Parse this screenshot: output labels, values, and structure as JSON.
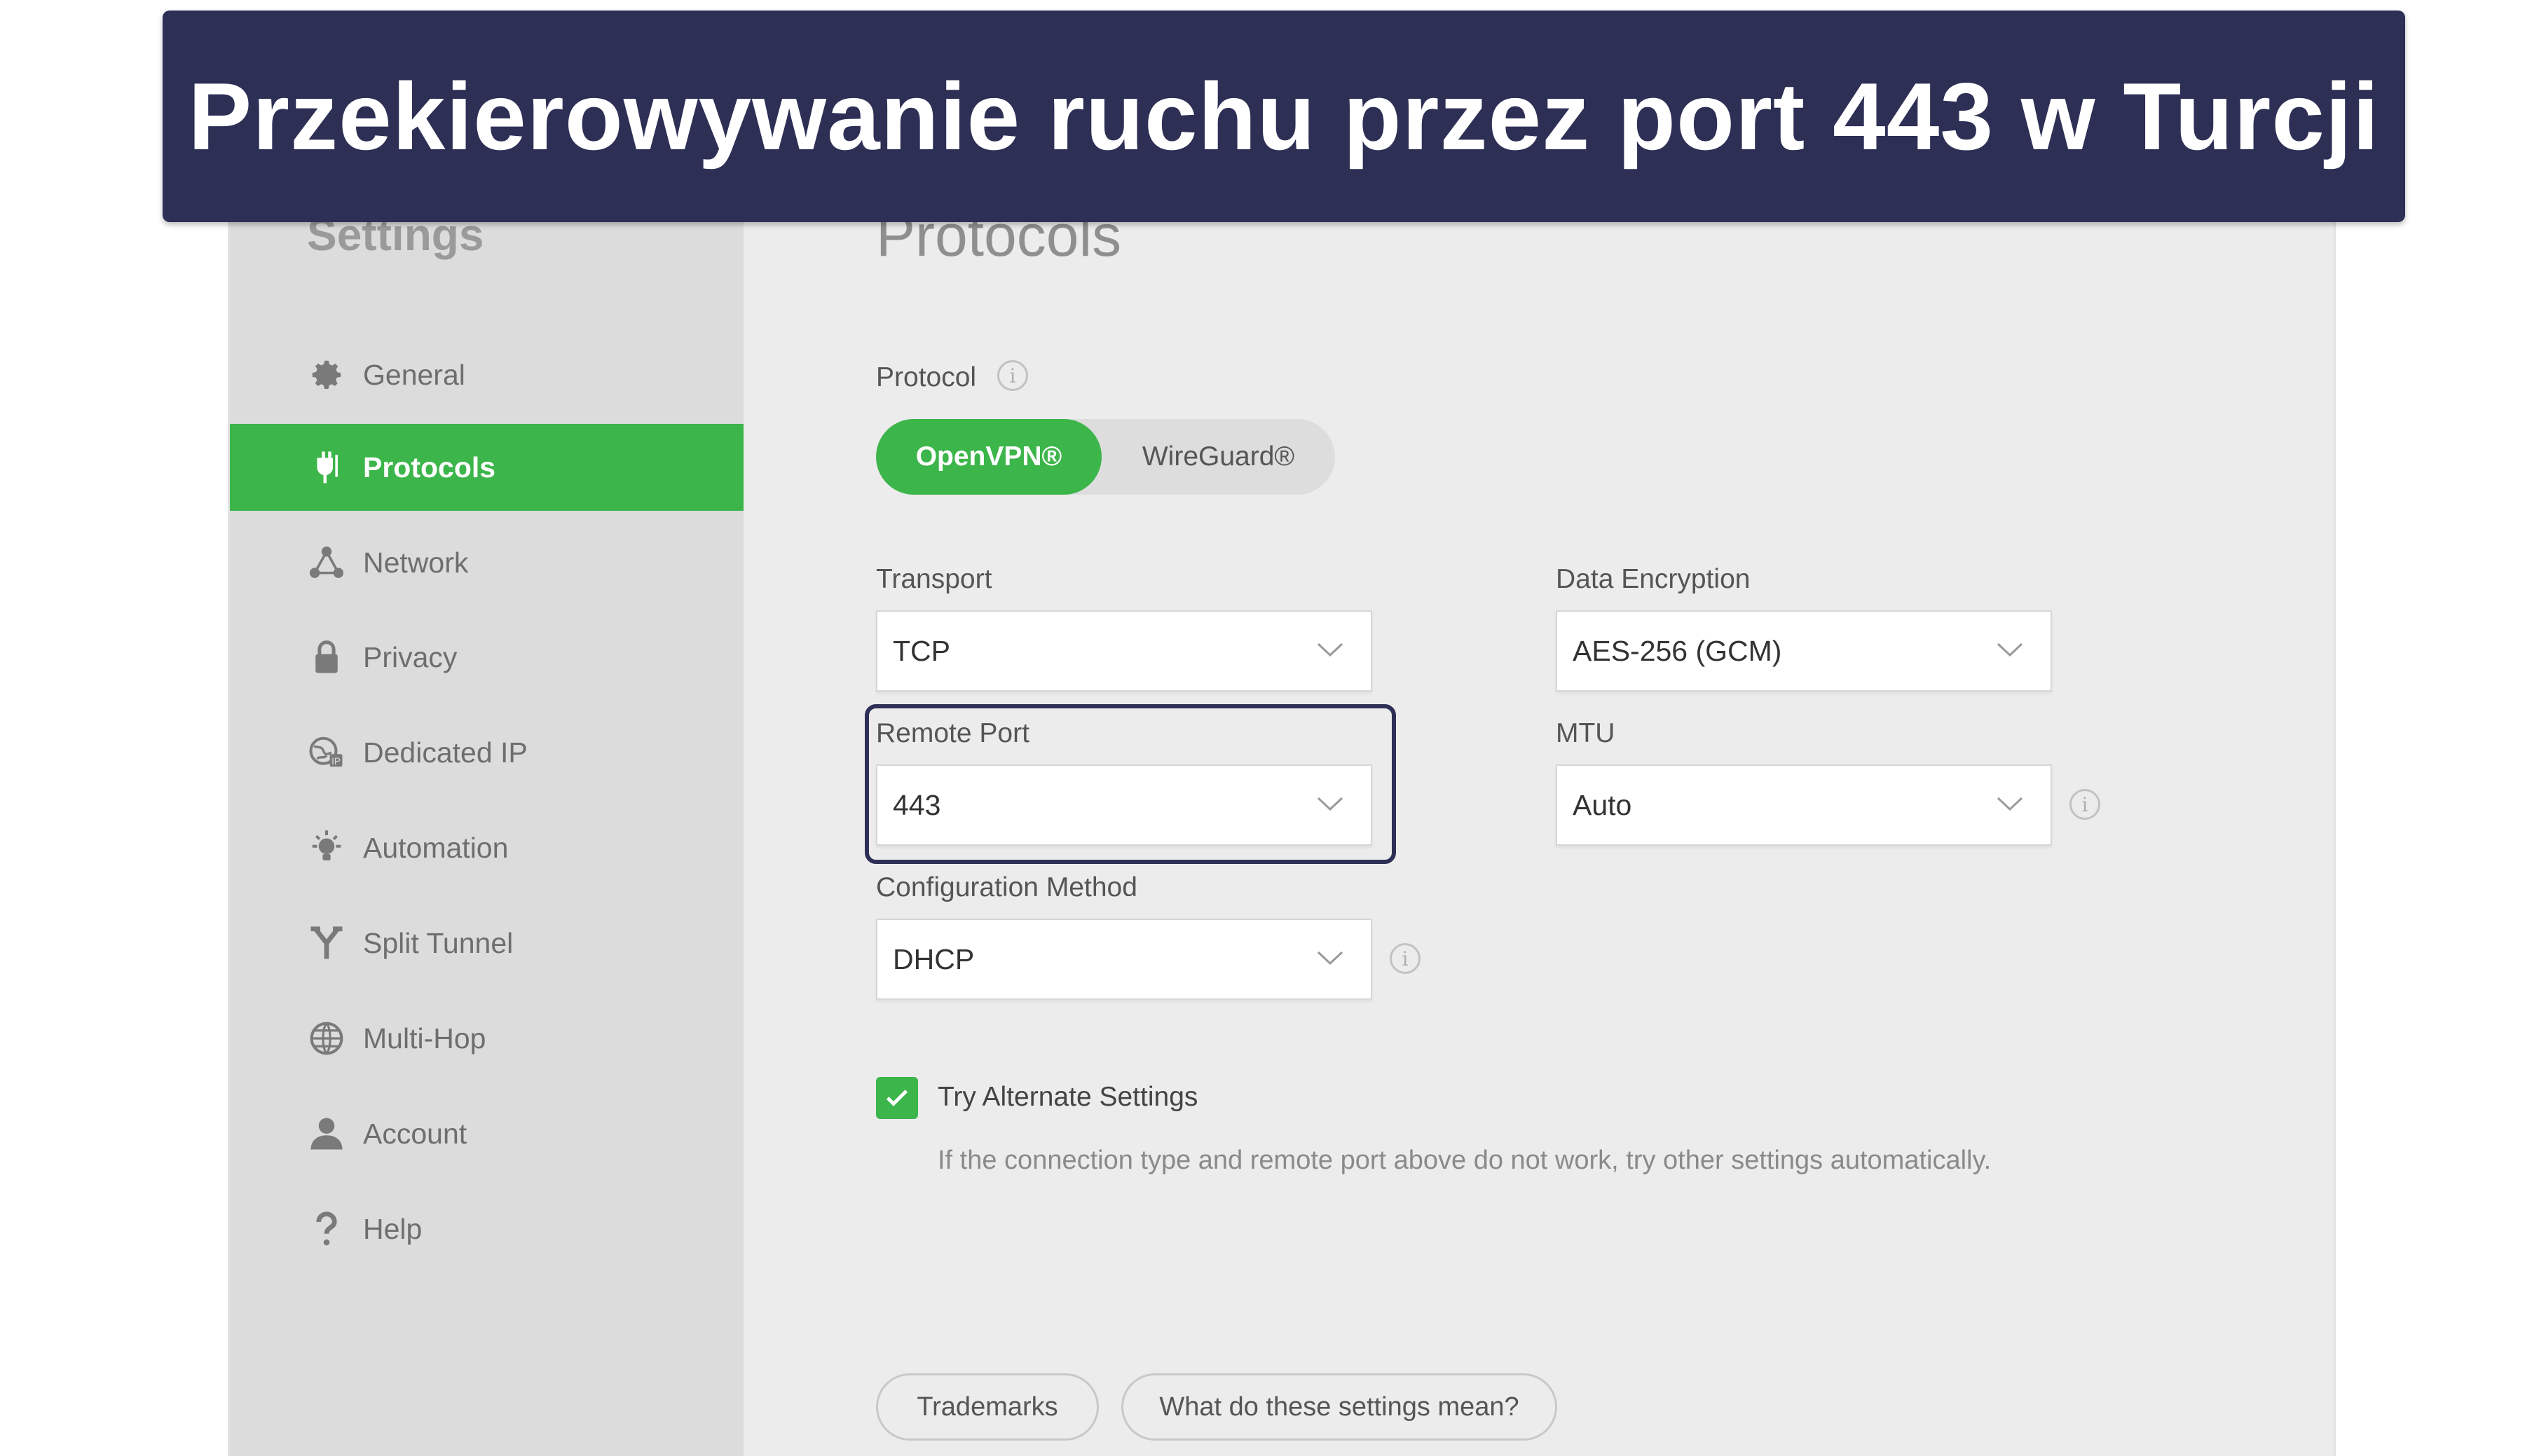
{
  "banner": {
    "text": "Przekierowywanie ruchu przez port 443 w Turcji"
  },
  "sidebar": {
    "title": "Settings",
    "items": [
      {
        "label": "General",
        "icon": "gear-icon"
      },
      {
        "label": "Protocols",
        "icon": "protocols-icon",
        "active": true
      },
      {
        "label": "Network",
        "icon": "network-icon"
      },
      {
        "label": "Privacy",
        "icon": "lock-icon"
      },
      {
        "label": "Dedicated IP",
        "icon": "dedicated-ip-icon"
      },
      {
        "label": "Automation",
        "icon": "lightbulb-icon"
      },
      {
        "label": "Split Tunnel",
        "icon": "split-tunnel-icon"
      },
      {
        "label": "Multi-Hop",
        "icon": "globe-icon"
      },
      {
        "label": "Account",
        "icon": "user-icon"
      },
      {
        "label": "Help",
        "icon": "question-icon"
      }
    ]
  },
  "main": {
    "title": "Protocols",
    "protocol_label": "Protocol",
    "protocol_options": [
      "OpenVPN®",
      "WireGuard®"
    ],
    "transport": {
      "label": "Transport",
      "value": "TCP"
    },
    "data_encryption": {
      "label": "Data Encryption",
      "value": "AES-256 (GCM)"
    },
    "remote_port": {
      "label": "Remote Port",
      "value": "443"
    },
    "mtu": {
      "label": "MTU",
      "value": "Auto"
    },
    "config_method": {
      "label": "Configuration Method",
      "value": "DHCP"
    },
    "alternate": {
      "label": "Try Alternate Settings",
      "checked": true,
      "description": "If the connection type and remote port above do not work, try other settings automatically."
    },
    "buttons": {
      "trademarks": "Trademarks",
      "settings_help": "What do these settings mean?"
    },
    "info_glyph": "i"
  },
  "colors": {
    "accent": "#3cb54a",
    "banner": "#2d2f55",
    "sidebar": "#dcdcdd",
    "content": "#ececec"
  }
}
